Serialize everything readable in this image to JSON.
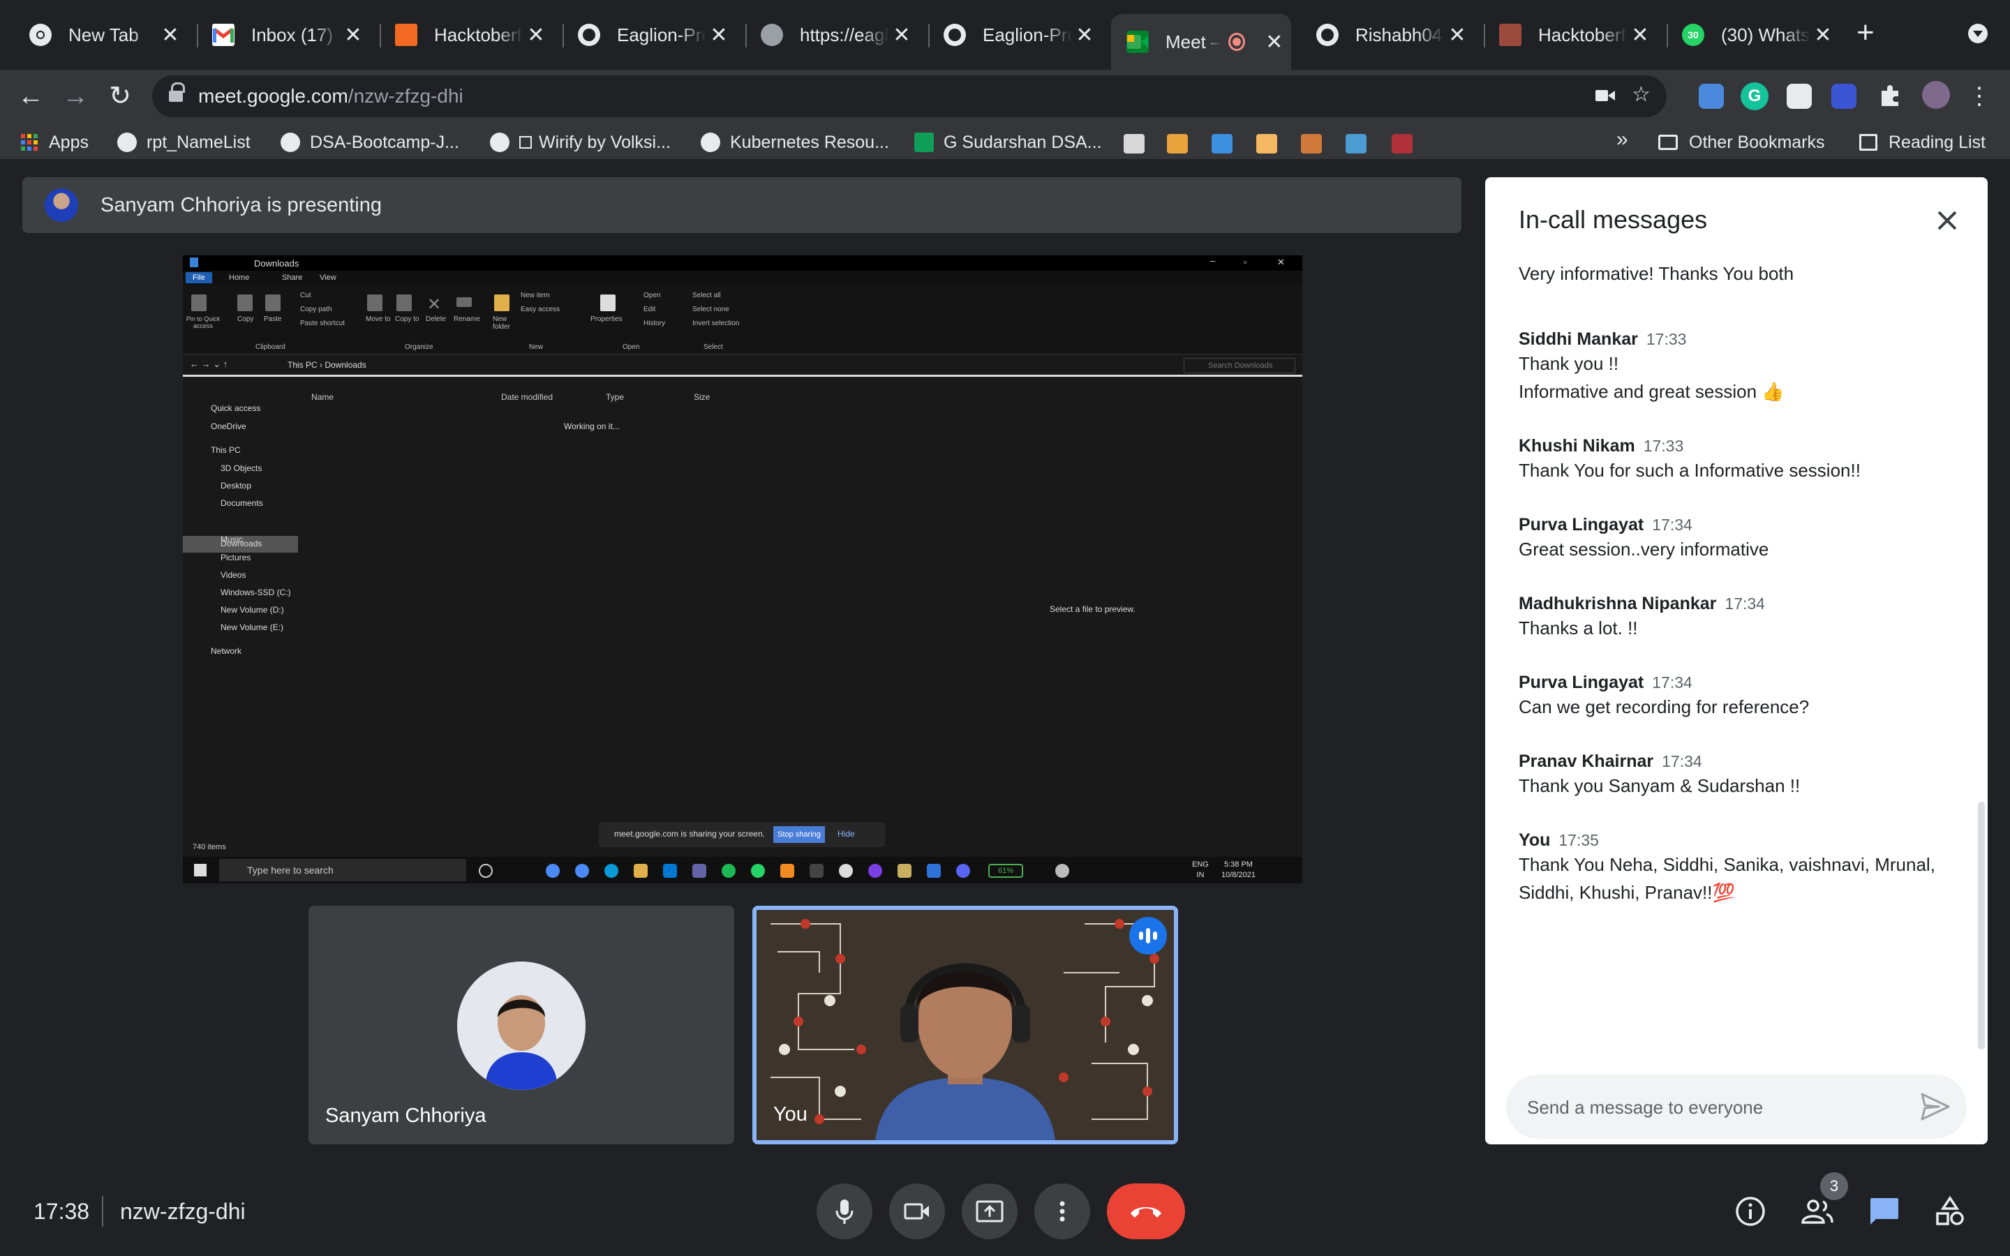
{
  "browser": {
    "tabs": [
      {
        "title": "New Tab",
        "icon": "chrome-icon"
      },
      {
        "title": "Inbox (17) -",
        "icon": "gmail-icon"
      },
      {
        "title": "Hacktoberfe",
        "icon": "hacktoberfest-icon"
      },
      {
        "title": "Eaglion-Pro",
        "icon": "github-icon"
      },
      {
        "title": "https://eagli",
        "icon": "globe-icon"
      },
      {
        "title": "Eaglion-Pro",
        "icon": "github-icon"
      },
      {
        "title": "Meet –",
        "icon": "meet-icon"
      },
      {
        "title": "Rishabh04-",
        "icon": "github-icon"
      },
      {
        "title": "Hacktoberfe",
        "icon": "hacktoberfest-icon"
      },
      {
        "title": "(30) Whats",
        "icon": "whatsapp-icon"
      }
    ],
    "url_host": "meet.google.com",
    "url_path": "/nzw-zfzg-dhi",
    "bookmarks": [
      {
        "label": "Apps"
      },
      {
        "label": "rpt_NameList"
      },
      {
        "label": "DSA-Bootcamp-J..."
      },
      {
        "label": "Wirify by Volksi..."
      },
      {
        "label": "Kubernetes Resou..."
      },
      {
        "label": "G Sudarshan DSA..."
      }
    ],
    "other_bookmarks": "Other Bookmarks",
    "reading_list": "Reading List",
    "chevron": "»"
  },
  "meet": {
    "presenting_text": "Sanyam Chhoriya is presenting",
    "time": "17:38",
    "meeting_code": "nzw-zfzg-dhi",
    "participant_count": "3",
    "participants": [
      {
        "name": "Sanyam Chhoriya"
      },
      {
        "name": "You"
      }
    ]
  },
  "shared_screen": {
    "window_title": "Downloads",
    "ribbon_tabs": [
      "File",
      "Home",
      "Share",
      "View"
    ],
    "ribbon_buttons": [
      "Pin to Quick access",
      "Copy",
      "Paste",
      "Cut",
      "Copy path",
      "Paste shortcut",
      "Move to",
      "Copy to",
      "Delete",
      "Rename",
      "New folder",
      "New item",
      "Easy access",
      "Properties",
      "Open",
      "Edit",
      "History",
      "Select all",
      "Select none",
      "Invert selection"
    ],
    "ribbon_groups": [
      "Clipboard",
      "Organize",
      "New",
      "Open",
      "Select"
    ],
    "breadcrumb": [
      "This PC",
      "Downloads"
    ],
    "search_placeholder": "Search Downloads",
    "nav_items": [
      "Quick access",
      "OneDrive",
      "This PC",
      "3D Objects",
      "Desktop",
      "Documents",
      "Downloads",
      "Music",
      "Pictures",
      "Videos",
      "Windows-SSD (C:)",
      "New Volume (D:)",
      "New Volume (E:)",
      "Network"
    ],
    "columns": [
      "Name",
      "Date modified",
      "Type",
      "Size"
    ],
    "working_text": "Working on it...",
    "preview_text": "Select a file to preview.",
    "item_count": "740 items",
    "share_text": "meet.google.com is sharing your screen.",
    "stop_sharing": "Stop sharing",
    "hide": "Hide",
    "taskbar_search": "Type here to search",
    "battery": "61%",
    "lang": "ENG",
    "lang2": "IN",
    "clock_time": "5:38 PM",
    "clock_date": "10/8/2021"
  },
  "chat": {
    "title": "In-call messages",
    "first_line": "Very informative! Thanks You both",
    "messages": [
      {
        "sender": "Siddhi Mankar",
        "time": "17:33",
        "lines": [
          "Thank you !!",
          "Informative and great session 👍"
        ]
      },
      {
        "sender": "Khushi Nikam",
        "time": "17:33",
        "lines": [
          "Thank You for such a Informative session!!"
        ]
      },
      {
        "sender": "Purva Lingayat",
        "time": "17:34",
        "lines": [
          "Great session..very informative"
        ]
      },
      {
        "sender": "Madhukrishna Nipankar",
        "time": "17:34",
        "lines": [
          "Thanks a lot. !!"
        ]
      },
      {
        "sender": "Purva Lingayat",
        "time": "17:34",
        "lines": [
          "Can we get recording for reference?"
        ]
      },
      {
        "sender": "Pranav Khairnar",
        "time": "17:34",
        "lines": [
          "Thank you Sanyam & Sudarshan !!"
        ]
      },
      {
        "sender": "You",
        "time": "17:35",
        "lines": [
          "Thank You Neha, Siddhi, Sanika, vaishnavi, Mrunal,",
          "Siddhi, Khushi, Pranav!!💯"
        ]
      }
    ],
    "input_placeholder": "Send a message to everyone"
  },
  "colors": {
    "end_call": "#ea4335",
    "accent": "#8ab4f8",
    "chat_active": "#8ab4f8"
  }
}
